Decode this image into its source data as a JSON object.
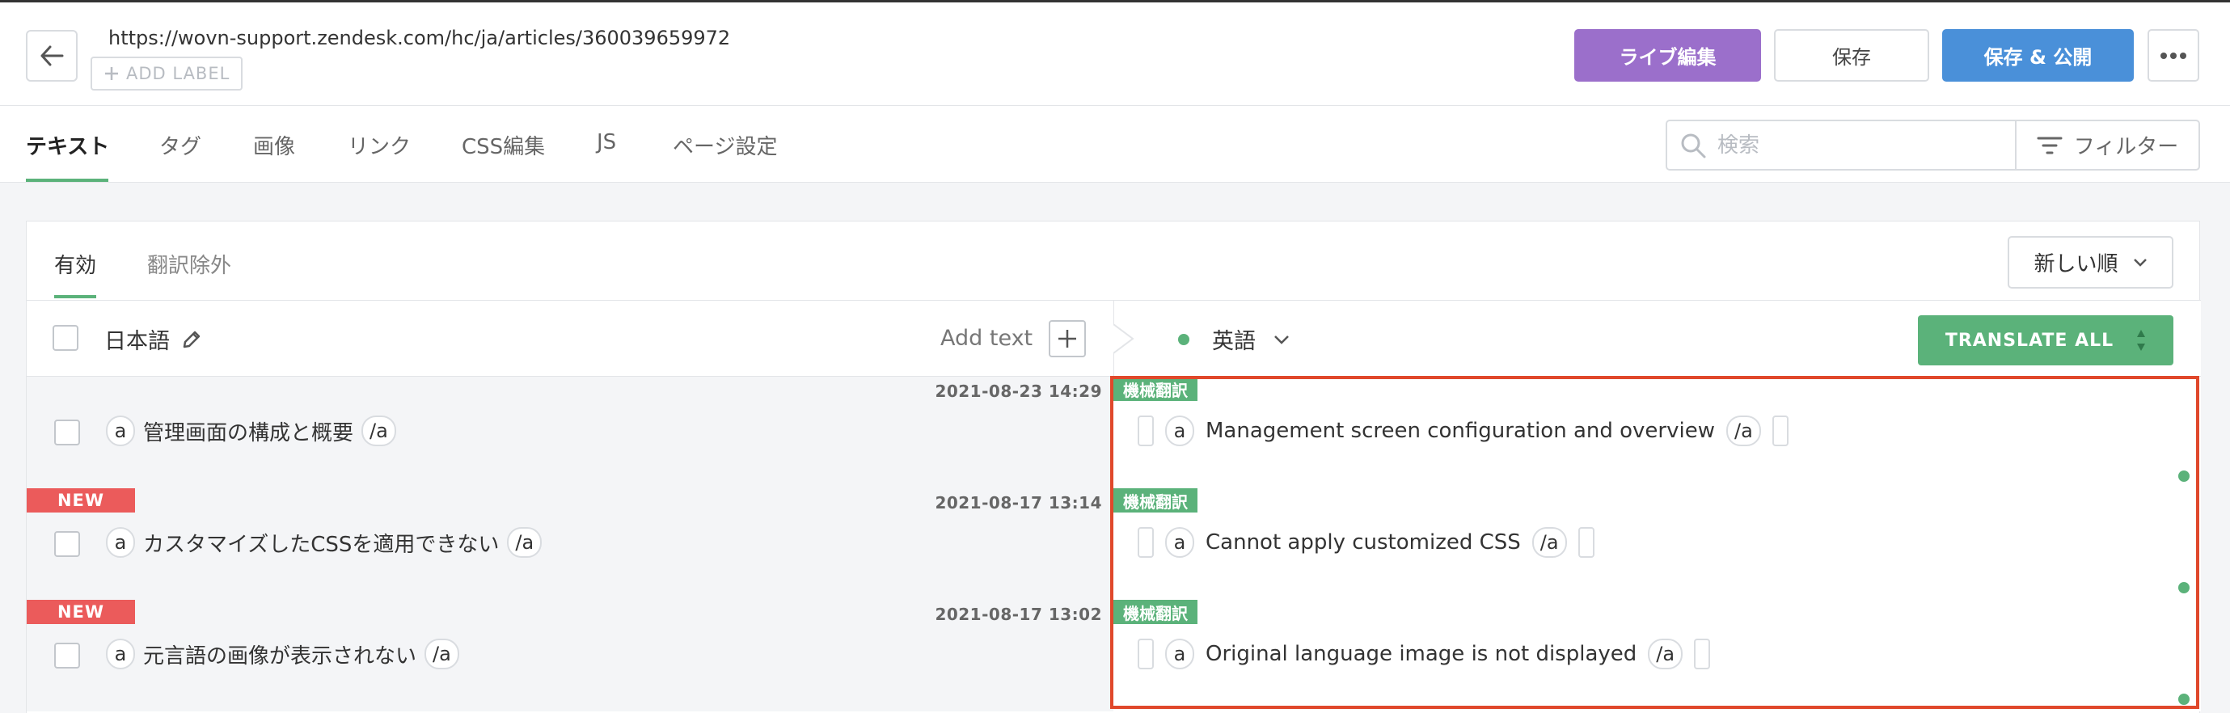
{
  "header": {
    "url": "https://wovn-support.zendesk.com/hc/ja/articles/360039659972",
    "add_label": "ADD LABEL",
    "live_edit": "ライブ編集",
    "save": "保存",
    "save_publish": "保存 & 公開"
  },
  "tabs": [
    "テキスト",
    "タグ",
    "画像",
    "リンク",
    "CSS編集",
    "JS",
    "ページ設定"
  ],
  "search": {
    "placeholder": "検索"
  },
  "filter": {
    "label": "フィルター"
  },
  "subtabs": [
    "有効",
    "翻訳除外"
  ],
  "sort": {
    "label": "新しい順"
  },
  "columns": {
    "source_language": "日本語",
    "add_text": "Add text",
    "target_language": "英語",
    "translate_all": "TRANSLATE ALL"
  },
  "rows": [
    {
      "badge": "",
      "date": "2021-08-23 14:29",
      "source_open_tag": "a",
      "source_text": "管理画面の構成と概要",
      "source_close_tag": "/a",
      "mt_badge": "機械翻訳",
      "target_open_tag": "a",
      "target_text": "Management screen configuration and overview",
      "target_close_tag": "/a"
    },
    {
      "badge": "NEW",
      "date": "2021-08-17 13:14",
      "source_open_tag": "a",
      "source_text": "カスタマイズしたCSSを適用できない",
      "source_close_tag": "/a",
      "mt_badge": "機械翻訳",
      "target_open_tag": "a",
      "target_text": "Cannot apply customized CSS",
      "target_close_tag": "/a"
    },
    {
      "badge": "NEW",
      "date": "2021-08-17 13:02",
      "source_open_tag": "a",
      "source_text": "元言語の画像が表示されない",
      "source_close_tag": "/a",
      "mt_badge": "機械翻訳",
      "target_open_tag": "a",
      "target_text": "Original language image is not displayed",
      "target_close_tag": "/a"
    }
  ],
  "colors": {
    "live_edit": "#9b6fcb",
    "publish": "#4a90d9",
    "accent_green": "#5bb27a",
    "new_badge": "#eb5b5b",
    "highlight": "#e0482b"
  }
}
